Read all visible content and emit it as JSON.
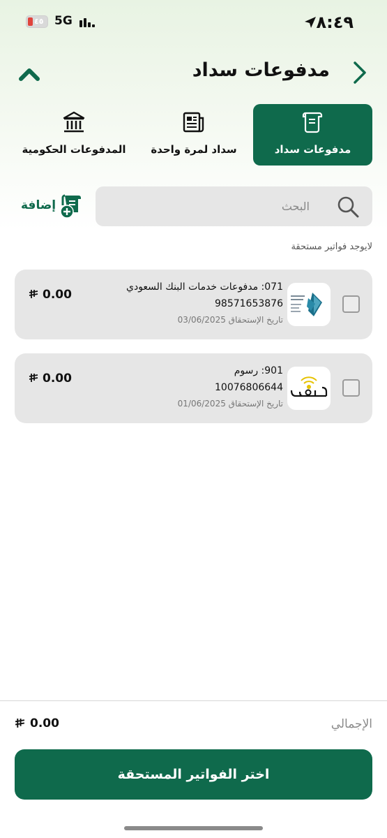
{
  "status_bar": {
    "time": "٨:٤٩",
    "network": "5G",
    "battery_text": "٤٥"
  },
  "header": {
    "title": "مدفوعات سداد"
  },
  "tabs": [
    {
      "label": "مدفوعات سداد",
      "icon": "scroll-bill-icon",
      "active": true
    },
    {
      "label": "سداد لمرة واحدة",
      "icon": "newspaper-icon",
      "active": false
    },
    {
      "label": "المدفوعات الحكومية",
      "icon": "government-building-icon",
      "active": false
    }
  ],
  "search": {
    "placeholder": "البحث",
    "value": ""
  },
  "add": {
    "label": "إضافة"
  },
  "no_due_bills_text": "لايوجد فواتير مستحقة",
  "bills": [
    {
      "title": "071: مدفوعات خدمات البنك السعودي ا...",
      "account": "98571653876",
      "due": "تاريخ الإستحقاق 03/06/2025",
      "amount": "0.00",
      "logo": "banque-saudi-fransi-logo"
    },
    {
      "title": "901: رسوم",
      "account": "10076806644",
      "due": "تاريخ الإستحقاق 01/06/2025",
      "amount": "0.00",
      "logo": "rusoom-logo"
    }
  ],
  "footer": {
    "total_label": "الإجمالي",
    "total_amount": "0.00",
    "cta_label": "اختر الفواتير المستحقة"
  },
  "colors": {
    "primary": "#0f6a4c",
    "card_bg": "#e6e6e6"
  }
}
